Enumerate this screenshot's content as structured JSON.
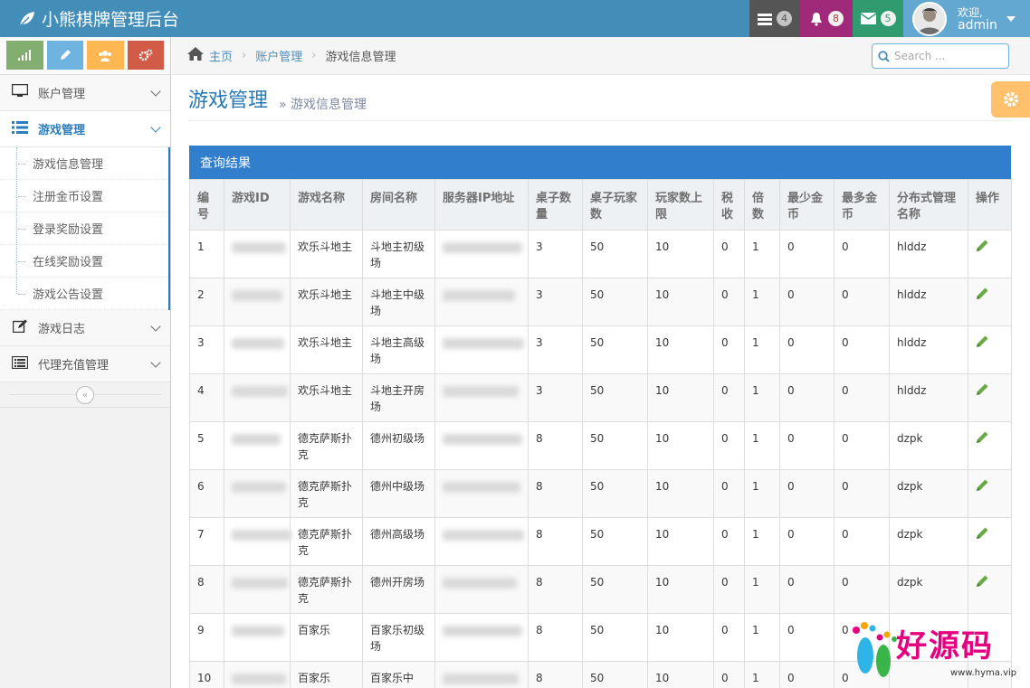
{
  "app": {
    "title": "小熊棋牌管理后台"
  },
  "navbar": {
    "tasks_count": "4",
    "notifications_count": "8",
    "messages_count": "5",
    "user_greeting": "欢迎,",
    "user_name": "admin"
  },
  "sidebar": {
    "shortcut_colors": [
      "#82af6f",
      "#6fb3e0",
      "#ffb752",
      "#d15b47"
    ],
    "menu": [
      {
        "label": "账户管理",
        "icon": "desktop-icon"
      },
      {
        "label": "游戏管理",
        "icon": "list-icon"
      },
      {
        "label": "游戏日志",
        "icon": "edit-icon"
      },
      {
        "label": "代理充值管理",
        "icon": "list-alt-icon"
      }
    ],
    "submenu": [
      "游戏信息管理",
      "注册金币设置",
      "登录奖励设置",
      "在线奖励设置",
      "游戏公告设置"
    ]
  },
  "breadcrumbs": {
    "home": "主页",
    "section": "账户管理",
    "current": "游戏信息管理"
  },
  "search": {
    "placeholder": "Search ..."
  },
  "page": {
    "title": "游戏管理",
    "subtitle": "» 游戏信息管理"
  },
  "panel": {
    "title": "查询结果"
  },
  "table": {
    "headers": [
      "编号",
      "游戏ID",
      "游戏名称",
      "房间名称",
      "服务器IP地址",
      "桌子数量",
      "桌子玩家数",
      "玩家数上限",
      "税收",
      "倍数",
      "最少金币",
      "最多金币",
      "分布式管理名称",
      "操作"
    ],
    "rows": [
      {
        "no": "1",
        "game": "欢乐斗地主",
        "room": "斗地主初级场",
        "tables": "3",
        "players": "50",
        "max": "10",
        "tax": "0",
        "mult": "1",
        "min": "0",
        "maxc": "0",
        "dist": "hlddz"
      },
      {
        "no": "2",
        "game": "欢乐斗地主",
        "room": "斗地主中级场",
        "tables": "3",
        "players": "50",
        "max": "10",
        "tax": "0",
        "mult": "1",
        "min": "0",
        "maxc": "0",
        "dist": "hlddz"
      },
      {
        "no": "3",
        "game": "欢乐斗地主",
        "room": "斗地主高级场",
        "tables": "3",
        "players": "50",
        "max": "10",
        "tax": "0",
        "mult": "1",
        "min": "0",
        "maxc": "0",
        "dist": "hlddz"
      },
      {
        "no": "4",
        "game": "欢乐斗地主",
        "room": "斗地主开房场",
        "tables": "3",
        "players": "50",
        "max": "10",
        "tax": "0",
        "mult": "1",
        "min": "0",
        "maxc": "0",
        "dist": "hlddz"
      },
      {
        "no": "5",
        "game": "德克萨斯扑克",
        "room": "德州初级场",
        "tables": "8",
        "players": "50",
        "max": "10",
        "tax": "0",
        "mult": "1",
        "min": "0",
        "maxc": "0",
        "dist": "dzpk"
      },
      {
        "no": "6",
        "game": "德克萨斯扑克",
        "room": "德州中级场",
        "tables": "8",
        "players": "50",
        "max": "10",
        "tax": "0",
        "mult": "1",
        "min": "0",
        "maxc": "0",
        "dist": "dzpk"
      },
      {
        "no": "7",
        "game": "德克萨斯扑克",
        "room": "德州高级场",
        "tables": "8",
        "players": "50",
        "max": "10",
        "tax": "0",
        "mult": "1",
        "min": "0",
        "maxc": "0",
        "dist": "dzpk"
      },
      {
        "no": "8",
        "game": "德克萨斯扑克",
        "room": "德州开房场",
        "tables": "8",
        "players": "50",
        "max": "10",
        "tax": "0",
        "mult": "1",
        "min": "0",
        "maxc": "0",
        "dist": "dzpk"
      },
      {
        "no": "9",
        "game": "百家乐",
        "room": "百家乐初级场",
        "tables": "8",
        "players": "50",
        "max": "10",
        "tax": "0",
        "mult": "1",
        "min": "0",
        "maxc": "0",
        "dist": ""
      },
      {
        "no": "10",
        "game": "百家乐",
        "room": "百家乐中",
        "tables": "8",
        "players": "50",
        "max": "10",
        "tax": "0",
        "mult": "1",
        "min": "0",
        "maxc": "0",
        "dist": ""
      }
    ]
  },
  "watermark": {
    "text": "好源码",
    "url": "www.hyma.vip"
  }
}
